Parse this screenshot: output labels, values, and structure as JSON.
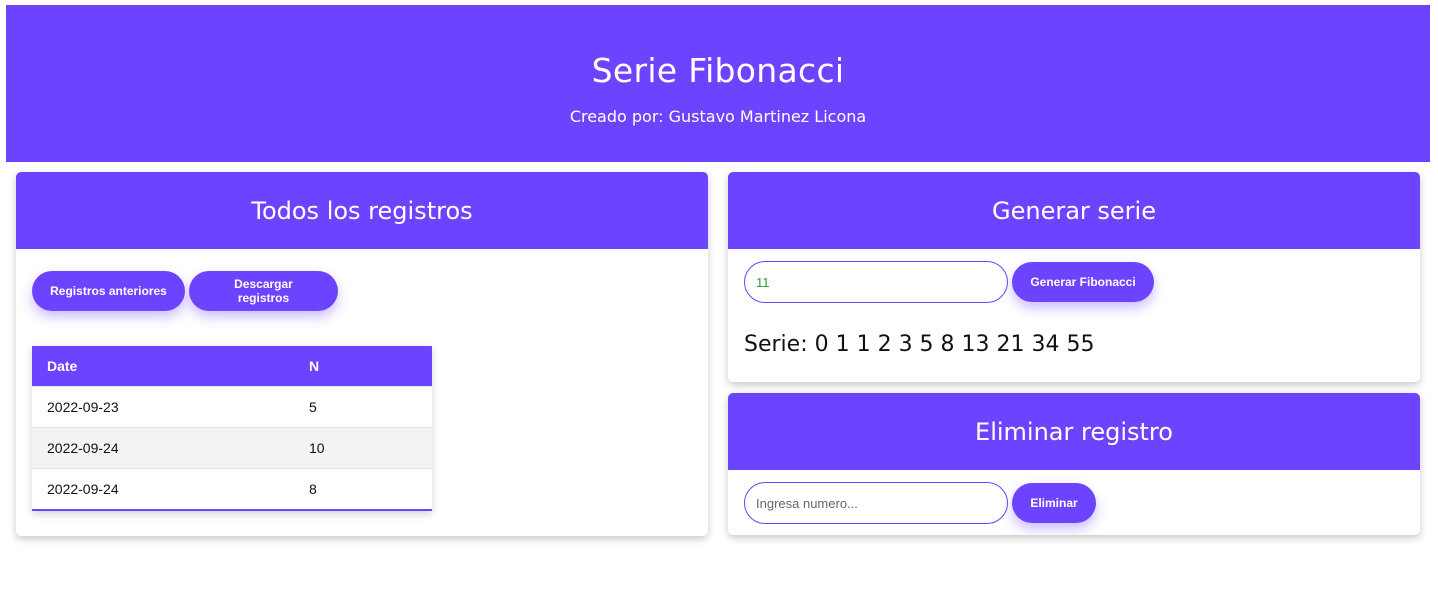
{
  "header": {
    "title": "Serie Fibonacci",
    "subtitle": "Creado por: Gustavo Martinez Licona"
  },
  "records": {
    "title": "Todos los registros",
    "buttons": {
      "previous": "Registros anteriores",
      "download": "Descargar registros"
    },
    "table": {
      "columns": [
        "Date",
        "N"
      ],
      "rows": [
        [
          "2022-09-23",
          "5"
        ],
        [
          "2022-09-24",
          "10"
        ],
        [
          "2022-09-24",
          "8"
        ]
      ]
    }
  },
  "generate": {
    "title": "Generar serie",
    "input_value": "11",
    "button": "Generar Fibonacci",
    "serie_label": "Serie:",
    "serie_values": "0 1 1 2 3 5 8 13 21 34 55"
  },
  "delete": {
    "title": "Eliminar registro",
    "input_placeholder": "Ingresa numero...",
    "button": "Eliminar"
  },
  "colors": {
    "accent": "#6c44ff",
    "input_value_text": "#2ca12c",
    "row_alt": "#f3f3f3"
  }
}
